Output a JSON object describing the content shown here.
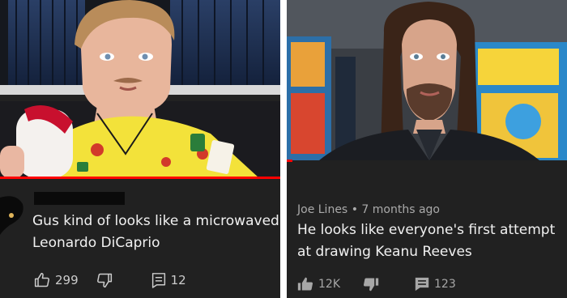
{
  "left_card": {
    "comment_text": "Gus kind of looks like a microwaved Leonardo DiCaprio",
    "like_count": "299",
    "reply_count": "12",
    "icons": {
      "like": "thumbs-up-outline-icon",
      "dislike": "thumbs-down-outline-icon",
      "reply": "comment-outline-icon"
    }
  },
  "right_card": {
    "author": "Joe Lines",
    "separator": "•",
    "timestamp": "7 months ago",
    "comment_text": "He looks like everyone's first attempt at drawing Keanu Reeves",
    "like_count": "12K",
    "reply_count": "123",
    "icons": {
      "like": "thumbs-up-filled-icon",
      "dislike": "thumbs-down-filled-icon",
      "reply": "comment-filled-icon"
    }
  },
  "colors": {
    "background": "#212121",
    "progress": "#ff0000",
    "text_primary": "#f1f1f1",
    "text_secondary": "#aaaaaa"
  }
}
